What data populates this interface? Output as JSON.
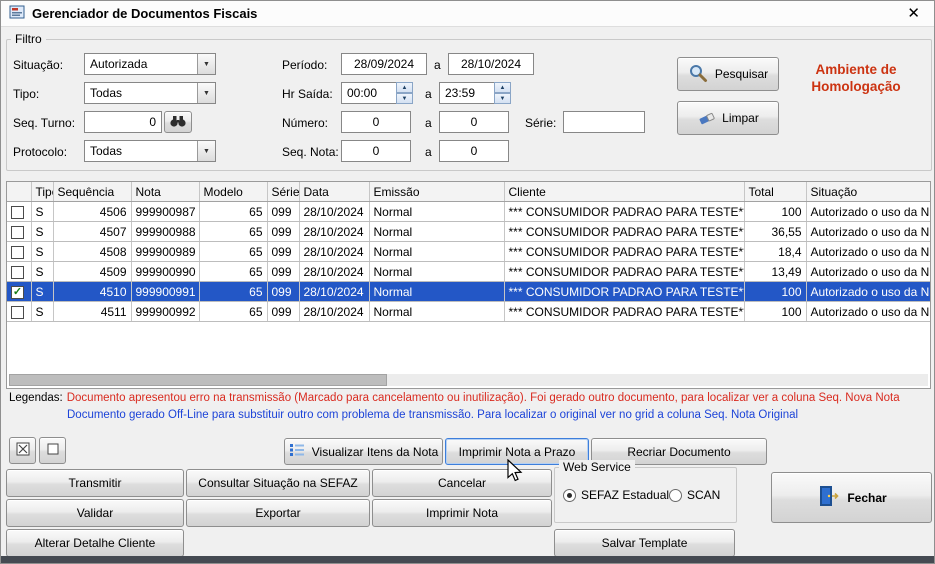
{
  "window": {
    "title": "Gerenciador de Documentos Fiscais"
  },
  "icons": {
    "close": "✕",
    "combo_arrow": "▼",
    "spin_up": "▲",
    "spin_down": "▼",
    "check": "✓"
  },
  "colors": {
    "selection": "#2357c6",
    "warning": "#cc3311",
    "legend-red": "#d92b20",
    "legend-blue": "#1d44d8"
  },
  "filter": {
    "group_label": "Filtro",
    "situacao_label": "Situação:",
    "situacao_value": "Autorizada",
    "tipo_label": "Tipo:",
    "tipo_value": "Todas",
    "seq_turno_label": "Seq. Turno:",
    "seq_turno_value": "0",
    "protocolo_label": "Protocolo:",
    "protocolo_value": "Todas",
    "periodo_label": "Período:",
    "periodo_from": "28/09/2024",
    "periodo_to": "28/10/2024",
    "range_sep": "a",
    "hr_saida_label": "Hr Saída:",
    "hr_from": "00:00",
    "hr_to": "23:59",
    "numero_label": "Número:",
    "numero_from": "0",
    "numero_to": "0",
    "serie_label": "Série:",
    "serie_value": "",
    "seq_nota_label": "Seq. Nota:",
    "seq_nota_from": "0",
    "seq_nota_to": "0",
    "pesquisar_label": "Pesquisar",
    "limpar_label": "Limpar",
    "ambiente_line1": "Ambiente de",
    "ambiente_line2": "Homologação"
  },
  "grid": {
    "columns": [
      "Tipo",
      "Sequência",
      "Nota",
      "Modelo",
      "Série",
      "Data",
      "Emissão",
      "Cliente",
      "Total",
      "Situação"
    ],
    "rows": [
      {
        "tipo": "S",
        "sequencia": "4506",
        "nota": "999900987",
        "modelo": "65",
        "serie": "099",
        "data": "28/10/2024",
        "emissao": "Normal",
        "cliente": "*** CONSUMIDOR PADRAO PARA TESTE**",
        "total": "100",
        "situacao": "Autorizado o uso da NF"
      },
      {
        "tipo": "S",
        "sequencia": "4507",
        "nota": "999900988",
        "modelo": "65",
        "serie": "099",
        "data": "28/10/2024",
        "emissao": "Normal",
        "cliente": "*** CONSUMIDOR PADRAO PARA TESTE**",
        "total": "36,55",
        "situacao": "Autorizado o uso da NF"
      },
      {
        "tipo": "S",
        "sequencia": "4508",
        "nota": "999900989",
        "modelo": "65",
        "serie": "099",
        "data": "28/10/2024",
        "emissao": "Normal",
        "cliente": "*** CONSUMIDOR PADRAO PARA TESTE**",
        "total": "18,4",
        "situacao": "Autorizado o uso da NF"
      },
      {
        "tipo": "S",
        "sequencia": "4509",
        "nota": "999900990",
        "modelo": "65",
        "serie": "099",
        "data": "28/10/2024",
        "emissao": "Normal",
        "cliente": "*** CONSUMIDOR PADRAO PARA TESTE**",
        "total": "13,49",
        "situacao": "Autorizado o uso da NF"
      },
      {
        "tipo": "S",
        "sequencia": "4510",
        "nota": "999900991",
        "modelo": "65",
        "serie": "099",
        "data": "28/10/2024",
        "emissao": "Normal",
        "cliente": "*** CONSUMIDOR PADRAO PARA TESTE**",
        "total": "100",
        "situacao": "Autorizado o uso da NF"
      },
      {
        "tipo": "S",
        "sequencia": "4511",
        "nota": "999900992",
        "modelo": "65",
        "serie": "099",
        "data": "28/10/2024",
        "emissao": "Normal",
        "cliente": "*** CONSUMIDOR PADRAO PARA TESTE**",
        "total": "100",
        "situacao": "Autorizado o uso da NF"
      }
    ]
  },
  "legend": {
    "label": "Legendas:",
    "red_text": "Documento apresentou erro na transmissão (Marcado para cancelamento ou inutilização). Foi gerado outro documento, para localizar ver a coluna Seq. Nova Nota",
    "blue_text": "Documento gerado Off-Line para substituir outro com problema  de transmissão. Para localizar o original ver no grid a coluna Seq. Nota Original"
  },
  "actions": {
    "visualizar_itens": "Visualizar Itens da Nota",
    "imprimir_prazo": "Imprimir Nota a Prazo",
    "recriar": "Recriar Documento",
    "transmitir": "Transmitir",
    "consultar_sefaz": "Consultar Situação na SEFAZ",
    "cancelar": "Cancelar",
    "validar": "Validar",
    "exportar": "Exportar",
    "imprimir_nota": "Imprimir Nota",
    "alterar_detalhe": "Alterar Detalhe Cliente",
    "salvar_template": "Salvar Template",
    "fechar": "Fechar"
  },
  "webservice": {
    "label": "Web Service",
    "option1": "SEFAZ Estadual",
    "option2": "SCAN"
  }
}
